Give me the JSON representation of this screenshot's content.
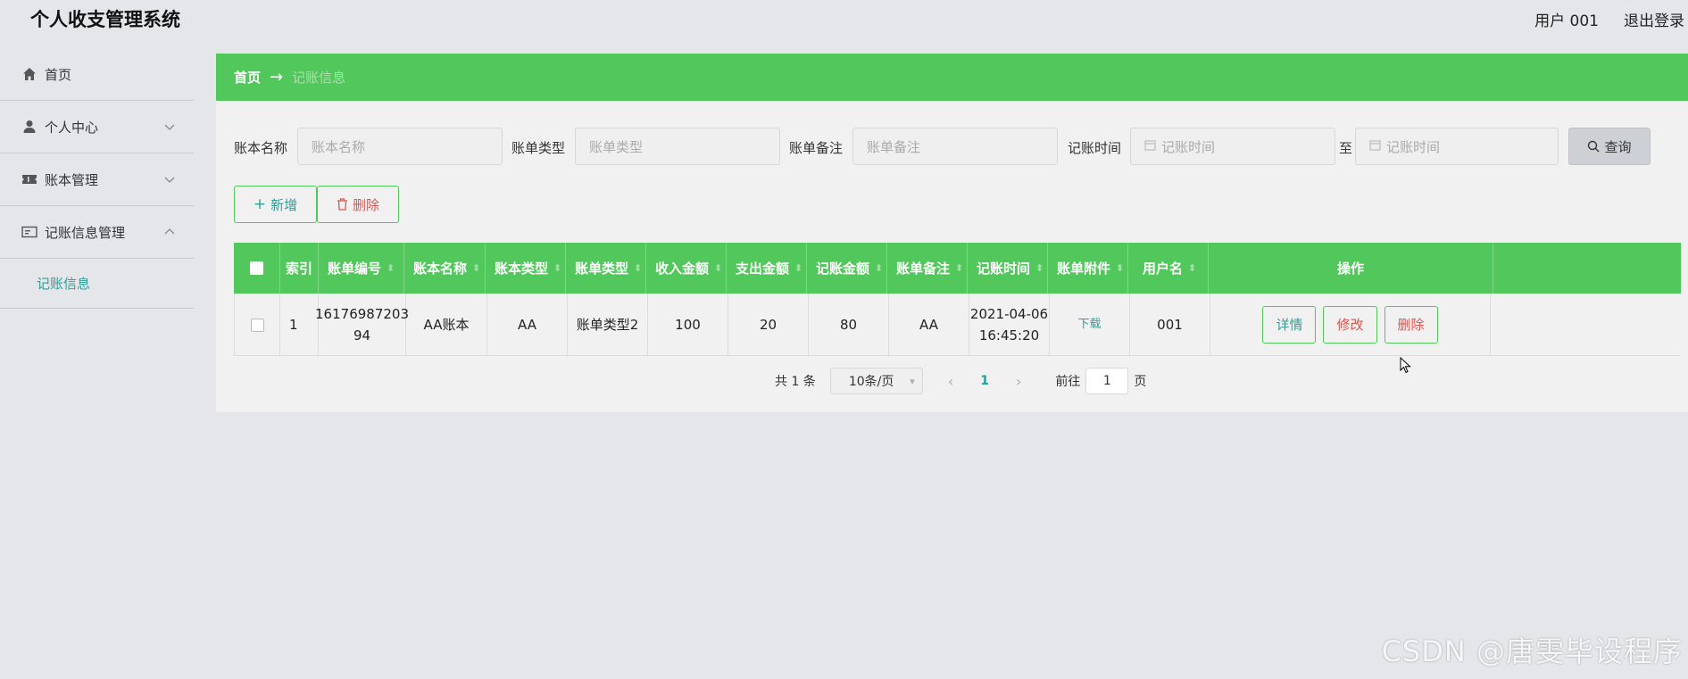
{
  "header": {
    "app_title": "个人收支管理系统",
    "user_label": "用户 001",
    "logout": "退出登录"
  },
  "sidebar": {
    "items": [
      {
        "label": "首页",
        "icon": "home-icon"
      },
      {
        "label": "个人中心",
        "icon": "user-icon"
      },
      {
        "label": "账本管理",
        "icon": "ticket-icon"
      },
      {
        "label": "记账信息管理",
        "icon": "card-icon"
      }
    ],
    "sub_item": "记账信息"
  },
  "breadcrumb": {
    "home": "首页",
    "arrow": "→",
    "current": "记账信息"
  },
  "search": {
    "fields": [
      {
        "label": "账本名称",
        "placeholder": "账本名称"
      },
      {
        "label": "账单类型",
        "placeholder": "账单类型"
      },
      {
        "label": "账单备注",
        "placeholder": "账单备注"
      },
      {
        "label": "记账时间",
        "placeholder": "记账时间"
      }
    ],
    "to_label": "至",
    "end_placeholder": "记账时间",
    "query_label": "查询"
  },
  "actions": {
    "add_label": "新增",
    "delete_label": "删除"
  },
  "table": {
    "headers": [
      "索引",
      "账单编号",
      "账本名称",
      "账本类型",
      "账单类型",
      "收入金额",
      "支出金额",
      "记账金额",
      "账单备注",
      "记账时间",
      "账单附件",
      "用户名",
      "操作"
    ],
    "rows": [
      {
        "index": "1",
        "bill_no_1": "16176987203",
        "bill_no_2": "94",
        "book_name": "AA账本",
        "book_type": "AA",
        "bill_type": "账单类型2",
        "income": "100",
        "expense": "20",
        "amount": "80",
        "remark": "AA",
        "time_date": "2021-04-06",
        "time_clock": "16:45:20",
        "attachment": "下载",
        "username": "001",
        "op_detail": "详情",
        "op_edit": "修改",
        "op_delete": "删除"
      }
    ]
  },
  "pagination": {
    "total": "共 1 条",
    "page_size": "10条/页",
    "current_page": "1",
    "goto_label": "前往",
    "goto_value": "1",
    "page_unit": "页"
  },
  "watermark": "CSDN @唐雯毕设程序",
  "colors": {
    "accent_green": "#52c75b",
    "teal_text": "#2aa198",
    "danger_red": "#e0554f"
  }
}
